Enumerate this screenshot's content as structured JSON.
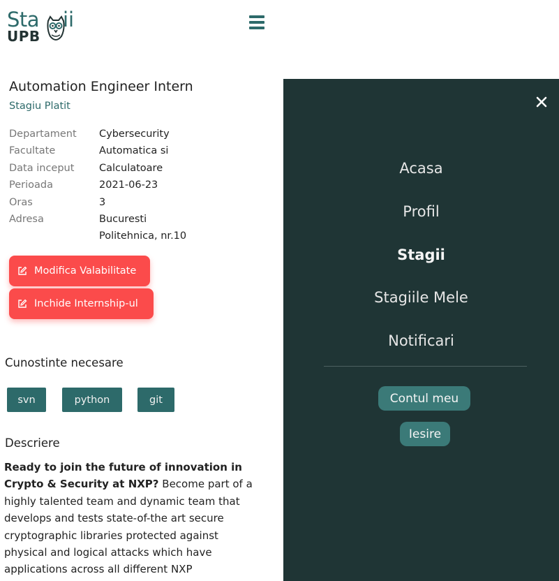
{
  "header": {
    "logo_sta": "Sta",
    "logo_ii": "ii",
    "logo_upb": "UPB",
    "brand_color": "#2d6a6a",
    "menu_icon": "hamburger-icon"
  },
  "job": {
    "title": "Automation Engineer Intern",
    "type": "Stagiu Platit",
    "details": [
      {
        "label": "Departament",
        "value": "Cybersecurity"
      },
      {
        "label": "Facultate",
        "value": "Automatica si"
      },
      {
        "label": "Data inceput",
        "value": "Calculatoare"
      },
      {
        "label": "Perioada",
        "value": "2021-06-23"
      },
      {
        "label": "Oras",
        "value": "3"
      },
      {
        "label": "Adresa",
        "value": "Bucuresti"
      },
      {
        "label": "",
        "value": "Politehnica, nr.10"
      }
    ]
  },
  "actions": {
    "modify_label": "Modifica Valabilitate",
    "close_label": "Inchide Internship-ul",
    "edit_icon": "edit-icon",
    "color": "#fb4b4b"
  },
  "skills": {
    "title": "Cunostinte necesare",
    "tags": [
      "svn",
      "python",
      "git"
    ]
  },
  "description": {
    "title": "Descriere",
    "bold": "Ready to join the future of innovation in Crypto & Security at NXP?",
    "text": " Become part of a highly talented team and dynamic team that develops and tests state-of-the art secure cryptographic libraries protected against physical and logical attacks which have applications across all different NXP"
  },
  "menu": {
    "background": "#1f3535",
    "close_icon": "close-icon",
    "items": [
      "Acasa",
      "Profil",
      "Stagii",
      "Stagiile Mele",
      "Notificari"
    ],
    "active": "Stagii",
    "account_button": "Contul meu",
    "logout_button": "Iesire"
  }
}
